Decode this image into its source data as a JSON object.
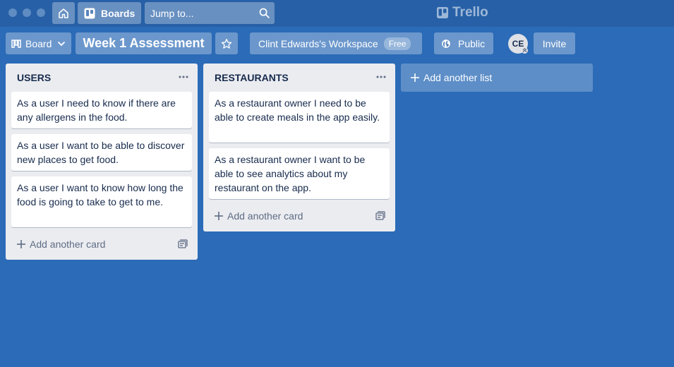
{
  "topbar": {
    "boards_label": "Boards",
    "search_placeholder": "Jump to...",
    "logo_text": "Trello"
  },
  "board_header": {
    "view_label": "Board",
    "title": "Week 1 Assessment",
    "workspace_label": "Clint Edwards's Workspace",
    "workspace_badge": "Free",
    "visibility_label": "Public",
    "avatar_initials": "CE",
    "invite_label": "Invite"
  },
  "lists": [
    {
      "title": "USERS",
      "cards": [
        "As a user I need to know if there are any allergens in the food.",
        "As a user I want to be able to discover new places to get food.",
        "As a user I want to know how long the food is going to take to get to me."
      ],
      "add_card_label": "Add another card"
    },
    {
      "title": "RESTAURANTS",
      "cards": [
        "As a restaurant owner I need to be able to create meals in the app easily.",
        "As a restaurant owner I want to be able to see analytics about my restaurant on the app."
      ],
      "add_card_label": "Add another card"
    }
  ],
  "add_list_label": "Add another list",
  "colors": {
    "board_background": "#2b6bb7",
    "topbar_background": "#2760a6",
    "list_background": "#ebecf0",
    "card_background": "#ffffff",
    "text_dark": "#172b4d",
    "text_muted": "#5e6c84"
  }
}
